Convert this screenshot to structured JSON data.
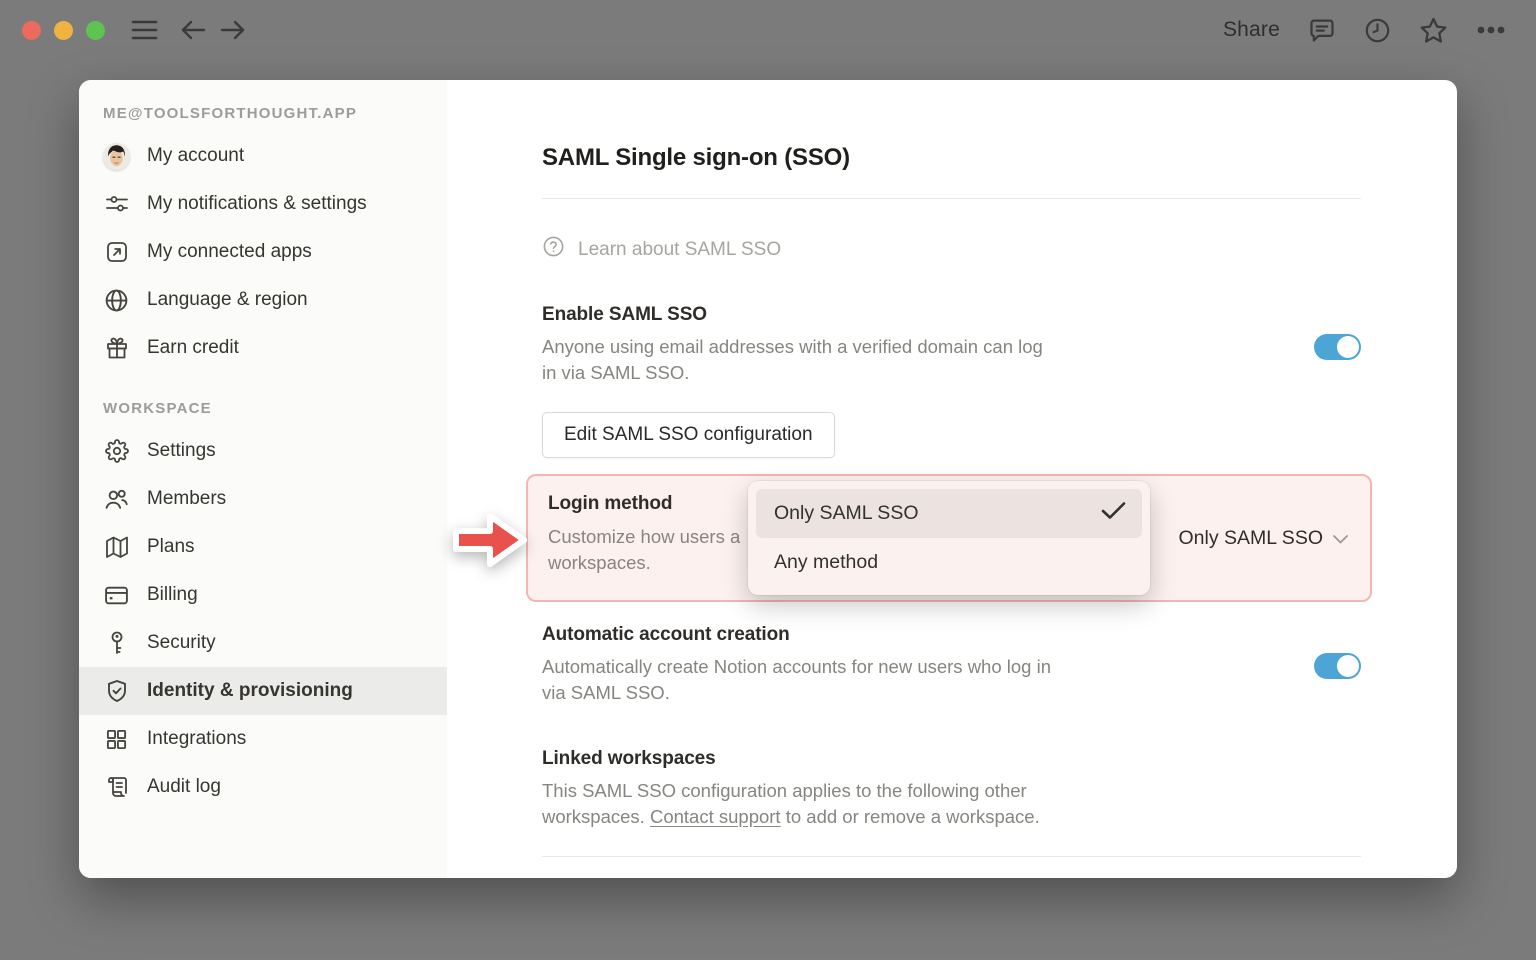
{
  "titlebar": {
    "share_label": "Share"
  },
  "sidebar": {
    "account_caption": "ME@TOOLSFORTHOUGHT.APP",
    "account_items": [
      {
        "label": "My account",
        "icon": "avatar"
      },
      {
        "label": "My notifications & settings",
        "icon": "sliders-icon"
      },
      {
        "label": "My connected apps",
        "icon": "arrow-up-right-box-icon"
      },
      {
        "label": "Language & region",
        "icon": "globe-icon"
      },
      {
        "label": "Earn credit",
        "icon": "gift-icon"
      }
    ],
    "workspace_caption": "WORKSPACE",
    "workspace_items": [
      {
        "label": "Settings",
        "icon": "gear-icon",
        "selected": false
      },
      {
        "label": "Members",
        "icon": "members-icon",
        "selected": false
      },
      {
        "label": "Plans",
        "icon": "map-icon",
        "selected": false
      },
      {
        "label": "Billing",
        "icon": "credit-card-icon",
        "selected": false
      },
      {
        "label": "Security",
        "icon": "key-icon",
        "selected": false
      },
      {
        "label": "Identity & provisioning",
        "icon": "shield-check-icon",
        "selected": true
      },
      {
        "label": "Integrations",
        "icon": "grid-icon",
        "selected": false
      },
      {
        "label": "Audit log",
        "icon": "scroll-icon",
        "selected": false
      }
    ]
  },
  "main": {
    "title": "SAML Single sign-on (SSO)",
    "learn_link": "Learn about SAML SSO",
    "enable": {
      "title": "Enable SAML SSO",
      "description": "Anyone using email addresses with a verified domain can log in via SAML SSO.",
      "toggle_on": true
    },
    "edit_button_label": "Edit SAML SSO configuration",
    "login_method": {
      "title": "Login method",
      "description_visible_line1": "Customize how users a",
      "description_visible_line2": "workspaces.",
      "selected_value": "Only SAML SSO",
      "dropdown_options": [
        {
          "label": "Only SAML SSO",
          "selected": true
        },
        {
          "label": "Any method",
          "selected": false
        }
      ]
    },
    "auto_account": {
      "title": "Automatic account creation",
      "description": "Automatically create Notion accounts for new users who log in via SAML SSO.",
      "toggle_on": true
    },
    "linked_workspaces": {
      "title": "Linked workspaces",
      "description_before_link": "This SAML SSO configuration applies to the following other workspaces. ",
      "link_text": "Contact support",
      "description_after_link": " to add or remove a workspace."
    }
  },
  "colors": {
    "accent_toggle_blue": "#4da5d5",
    "highlight_pink_bg": "#fdf1ef",
    "highlight_pink_border": "#f4b6b2",
    "callout_arrow_red": "#e9524c",
    "selected_row_gray": "#ebebea",
    "overlay_background": "#7b7b7b"
  }
}
